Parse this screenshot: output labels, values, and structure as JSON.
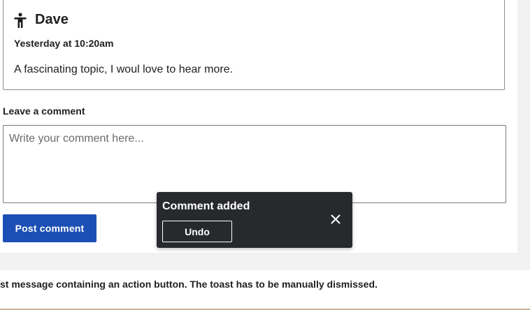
{
  "comment": {
    "author": "Dave",
    "author_icon": "person-icon",
    "timestamp": "Yesterday at 10:20am",
    "text": "A fascinating topic, I woul love to hear more."
  },
  "form": {
    "label": "Leave a comment",
    "placeholder": "Write your comment here...",
    "value": "",
    "submit_label": "Post comment"
  },
  "toast": {
    "title": "Comment added",
    "action_label": "Undo",
    "close_icon": "close-icon"
  },
  "description": "st message containing an action button. The toast has to be manually dismissed.",
  "colors": {
    "primary": "#1b4fb5",
    "toast_bg": "#27292d",
    "page_bg": "#f2f2f2",
    "accent_rule": "#c7b690"
  }
}
